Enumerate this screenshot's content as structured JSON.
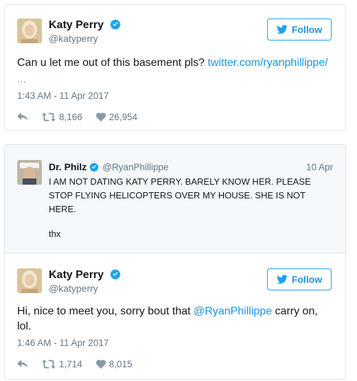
{
  "tweet1": {
    "display_name": "Katy Perry",
    "handle": "@katyperry",
    "follow_label": "Follow",
    "text_before": "Can u let me out of this basement pls? ",
    "link": "twitter.com/ryanphillippe/",
    "ellipsis": "…",
    "timestamp": "1:43 AM - 11 Apr 2017",
    "retweets": "8,166",
    "likes": "26,954"
  },
  "quoted": {
    "display_name": "Dr. Philz",
    "handle": "@RyanPhillippe",
    "date": "10 Apr",
    "text": "I AM NOT DATING KATY PERRY. BARELY KNOW HER. PLEASE STOP FLYING HELICOPTERS OVER MY HOUSE. SHE IS NOT HERE.",
    "signoff": "thx"
  },
  "tweet2": {
    "display_name": "Katy Perry",
    "handle": "@katyperry",
    "follow_label": "Follow",
    "text_before": "Hi, nice to meet you, sorry bout that ",
    "mention": "@RyanPhillippe",
    "text_after": " carry on, lol.",
    "timestamp": "1:46 AM - 11 Apr 2017",
    "retweets": "1,714",
    "likes": "8,015"
  },
  "icons": {
    "verified": "verified-badge-icon",
    "follow": "twitter-bird-icon",
    "reply": "reply-icon",
    "retweet": "retweet-icon",
    "like": "heart-icon"
  },
  "colors": {
    "accent": "#1da1f2",
    "link": "#1b95e0",
    "muted": "#657786",
    "border": "#e1e8ed",
    "quote_bg": "#f5f8fa"
  }
}
